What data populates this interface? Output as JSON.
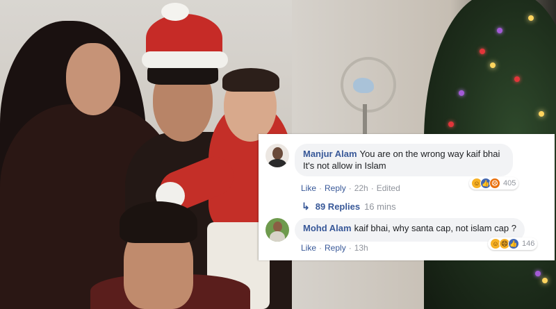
{
  "comments": [
    {
      "author": "Manjur Alam",
      "text": "You are on the wrong way kaif bhai It's not allow in Islam",
      "like_label": "Like",
      "reply_label": "Reply",
      "time": "22h",
      "edited_label": "Edited",
      "reaction_count": "405",
      "reactions": [
        "haha-icon",
        "like-icon",
        "angry-icon"
      ],
      "replies": {
        "count_label": "89 Replies",
        "time": "16 mins"
      }
    },
    {
      "author": "Mohd Alam",
      "text": "kaif bhai, why santa cap, not islam cap ?",
      "like_label": "Like",
      "reply_label": "Reply",
      "time": "13h",
      "reaction_count": "146",
      "reactions": [
        "haha-icon",
        "sad-icon",
        "like-icon"
      ]
    }
  ],
  "colors": {
    "link": "#385898",
    "meta": "#90949c",
    "bubble": "#f2f3f5",
    "hat_red": "#c62b27"
  }
}
